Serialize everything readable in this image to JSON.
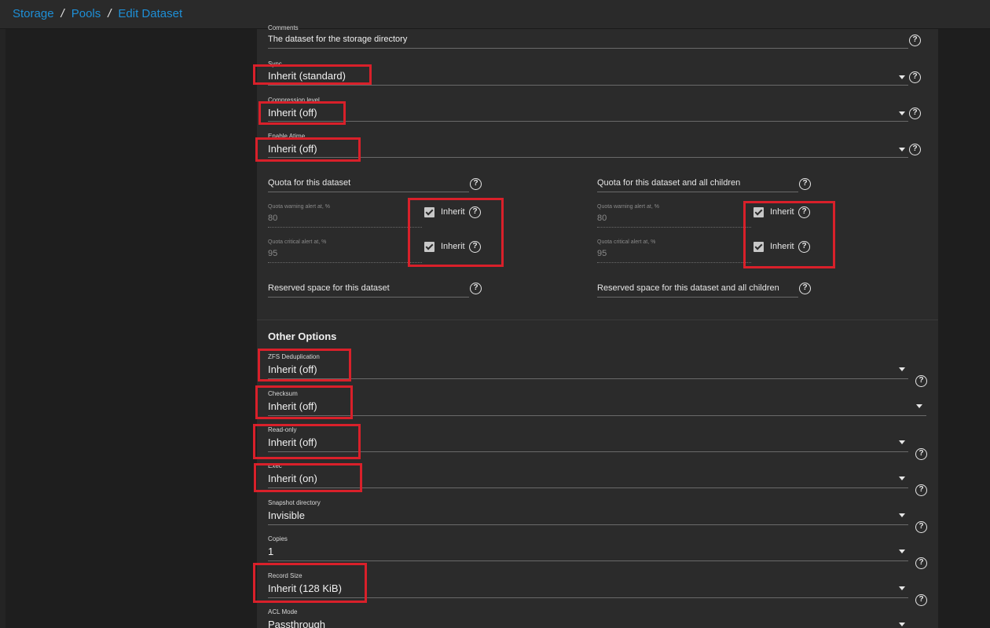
{
  "breadcrumb": {
    "storage": "Storage",
    "pools": "Pools",
    "edit": "Edit Dataset",
    "sep": "/"
  },
  "comments": {
    "label": "Comments",
    "value": "The dataset for the storage directory"
  },
  "sync": {
    "label": "Sync",
    "value": "Inherit (standard)"
  },
  "compression": {
    "label": "Compression level",
    "value": "Inherit (off)"
  },
  "atime": {
    "label": "Enable Atime",
    "value": "Inherit (off)"
  },
  "quota_dataset": {
    "title": "Quota for this dataset",
    "warning_label": "Quota warning alert at, %",
    "warning_value": "80",
    "critical_label": "Quota critical alert at, %",
    "critical_value": "95",
    "inherit_label": "Inherit"
  },
  "quota_children": {
    "title": "Quota for this dataset and all children",
    "warning_label": "Quota warning alert at, %",
    "warning_value": "80",
    "critical_label": "Quota critical alert at, %",
    "critical_value": "95",
    "inherit_label": "Inherit"
  },
  "reserved_dataset": {
    "title": "Reserved space for this dataset"
  },
  "reserved_children": {
    "title": "Reserved space for this dataset and all children"
  },
  "other_options": {
    "title": "Other Options"
  },
  "dedup": {
    "label": "ZFS Deduplication",
    "value": "Inherit (off)"
  },
  "checksum": {
    "label": "Checksum",
    "value": "Inherit (off)"
  },
  "readonly": {
    "label": "Read-only",
    "value": "Inherit (off)"
  },
  "exec": {
    "label": "Exec",
    "value": "Inherit (on)"
  },
  "snapdir": {
    "label": "Snapshot directory",
    "value": "Invisible"
  },
  "copies": {
    "label": "Copies",
    "value": "1"
  },
  "recordsize": {
    "label": "Record Size",
    "value": "Inherit (128 KiB)"
  },
  "aclmode": {
    "label": "ACL Mode",
    "value": "Passthrough"
  },
  "icons": {
    "help": "?",
    "help_icon_name": "help-circle-icon",
    "caret_icon_name": "chevron-down-icon",
    "check_icon_name": "checkbox-checked-icon"
  },
  "colors": {
    "accent": "#1e8fd6",
    "highlight": "#d9202a",
    "card": "#2b2b2b",
    "background": "#1e1e1e"
  }
}
